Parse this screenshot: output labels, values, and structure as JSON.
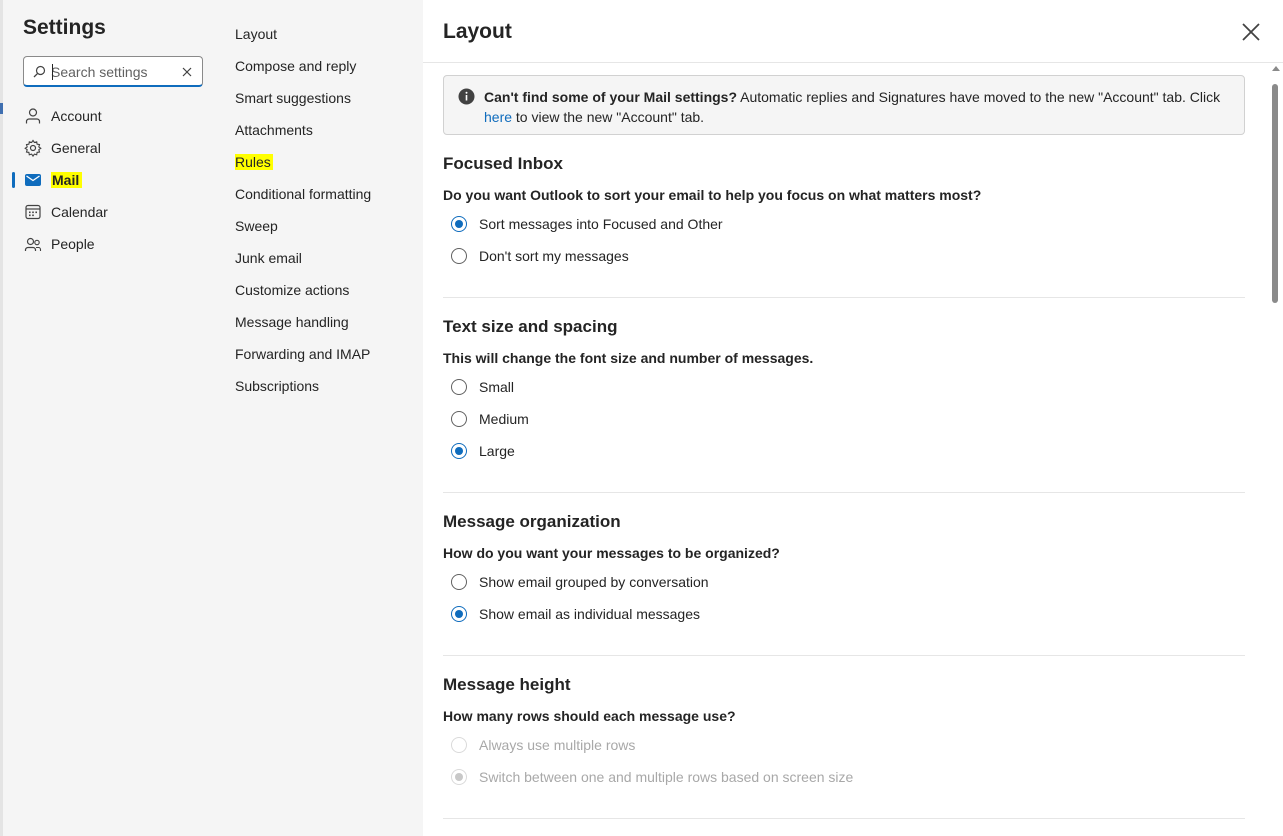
{
  "settings": {
    "title": "Settings",
    "search": {
      "placeholder": "Search settings",
      "value": ""
    },
    "nav": [
      {
        "label": "Account",
        "icon": "person-icon"
      },
      {
        "label": "General",
        "icon": "gear-icon"
      },
      {
        "label": "Mail",
        "icon": "mail-icon",
        "selected": true
      },
      {
        "label": "Calendar",
        "icon": "calendar-icon"
      },
      {
        "label": "People",
        "icon": "people-icon"
      }
    ]
  },
  "mail_nav": [
    {
      "label": "Layout"
    },
    {
      "label": "Compose and reply"
    },
    {
      "label": "Smart suggestions"
    },
    {
      "label": "Attachments"
    },
    {
      "label": "Rules",
      "highlighted": true
    },
    {
      "label": "Conditional formatting"
    },
    {
      "label": "Sweep"
    },
    {
      "label": "Junk email"
    },
    {
      "label": "Customize actions"
    },
    {
      "label": "Message handling"
    },
    {
      "label": "Forwarding and IMAP"
    },
    {
      "label": "Subscriptions"
    }
  ],
  "main": {
    "title": "Layout",
    "info": {
      "bold": "Can't find some of your Mail settings?",
      "text1": " Automatic replies and Signatures have moved to the new \"Account\" tab. Click ",
      "link": "here",
      "text2": " to view the new \"Account\" tab."
    },
    "sections": [
      {
        "title": "Focused Inbox",
        "question": "Do you want Outlook to sort your email to help you focus on what matters most?",
        "options": [
          {
            "label": "Sort messages into Focused and Other",
            "checked": true
          },
          {
            "label": "Don't sort my messages",
            "checked": false
          }
        ]
      },
      {
        "title": "Text size and spacing",
        "question": "This will change the font size and number of messages.",
        "options": [
          {
            "label": "Small",
            "checked": false
          },
          {
            "label": "Medium",
            "checked": false
          },
          {
            "label": "Large",
            "checked": true
          }
        ]
      },
      {
        "title": "Message organization",
        "question": "How do you want your messages to be organized?",
        "options": [
          {
            "label": "Show email grouped by conversation",
            "checked": false
          },
          {
            "label": "Show email as individual messages",
            "checked": true
          }
        ]
      },
      {
        "title": "Message height",
        "question": "How many rows should each message use?",
        "options": [
          {
            "label": "Always use multiple rows",
            "checked": false,
            "disabled": true
          },
          {
            "label": "Switch between one and multiple rows based on screen size",
            "checked": true,
            "disabled": true
          }
        ]
      }
    ]
  },
  "colors": {
    "accent": "#0f6cbd",
    "highlight": "#ffff00",
    "pane_bg": "#f5f5f5"
  }
}
